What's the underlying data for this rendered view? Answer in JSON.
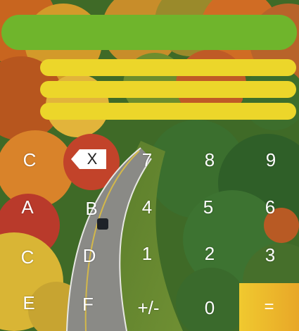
{
  "display": {
    "expression": "",
    "history": [
      "",
      "",
      ""
    ]
  },
  "colors": {
    "display": "#6fb52c",
    "history_bars": "#ecd62a",
    "equals": "#f0c92f",
    "key_text": "#ffffff"
  },
  "background": {
    "description_icon": "autumn-forest-road-photo"
  },
  "keys": {
    "clear": "C",
    "backspace": "X",
    "seven": "7",
    "eight": "8",
    "nine": "9",
    "hex_a": "A",
    "hex_b": "B",
    "four": "4",
    "five": "5",
    "six": "6",
    "hex_c": "C",
    "hex_d": "D",
    "one": "1",
    "two": "2",
    "three": "3",
    "hex_e": "E",
    "hex_f": "F",
    "negate": "+/-",
    "zero": "0",
    "equals": "="
  }
}
